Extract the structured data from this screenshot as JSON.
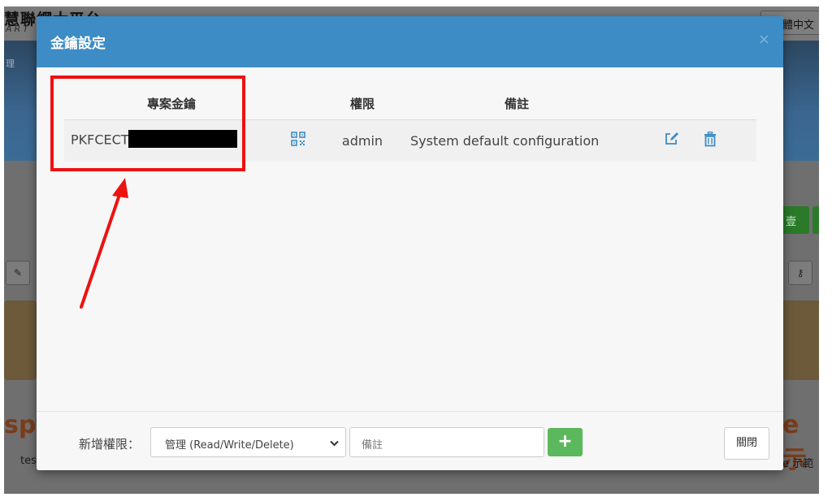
{
  "background": {
    "logo": "慧聯網大平台",
    "logo_sub": "ART",
    "language": "體中文",
    "banner_text": "理",
    "green_button": "壹",
    "orange_left": "spt",
    "orange_right": "e 示",
    "small_left": "tes",
    "small_right": "e 示範"
  },
  "modal": {
    "title": "金鑰設定",
    "close_glyph": "×",
    "table": {
      "headers": [
        "專案金鑰",
        "",
        "權限",
        "備註",
        ""
      ],
      "rows": [
        {
          "key_prefix": "PKFCECT",
          "permission": "admin",
          "note": "System default configuration"
        }
      ]
    },
    "footer": {
      "permission_label": "新增權限：",
      "permission_select_value": "管理 (Read/Write/Delete)",
      "note_placeholder": "備註",
      "add_glyph": "+",
      "close_label": "關閉"
    }
  },
  "colors": {
    "header_blue": "#3d8cc5",
    "icon_blue": "#3d8cc5",
    "add_green": "#5cb85c",
    "annotation_red": "#ee1111"
  },
  "icons": [
    "qr-code-icon",
    "edit-icon",
    "trash-icon",
    "chevron-down-icon",
    "plus-icon",
    "close-icon"
  ]
}
